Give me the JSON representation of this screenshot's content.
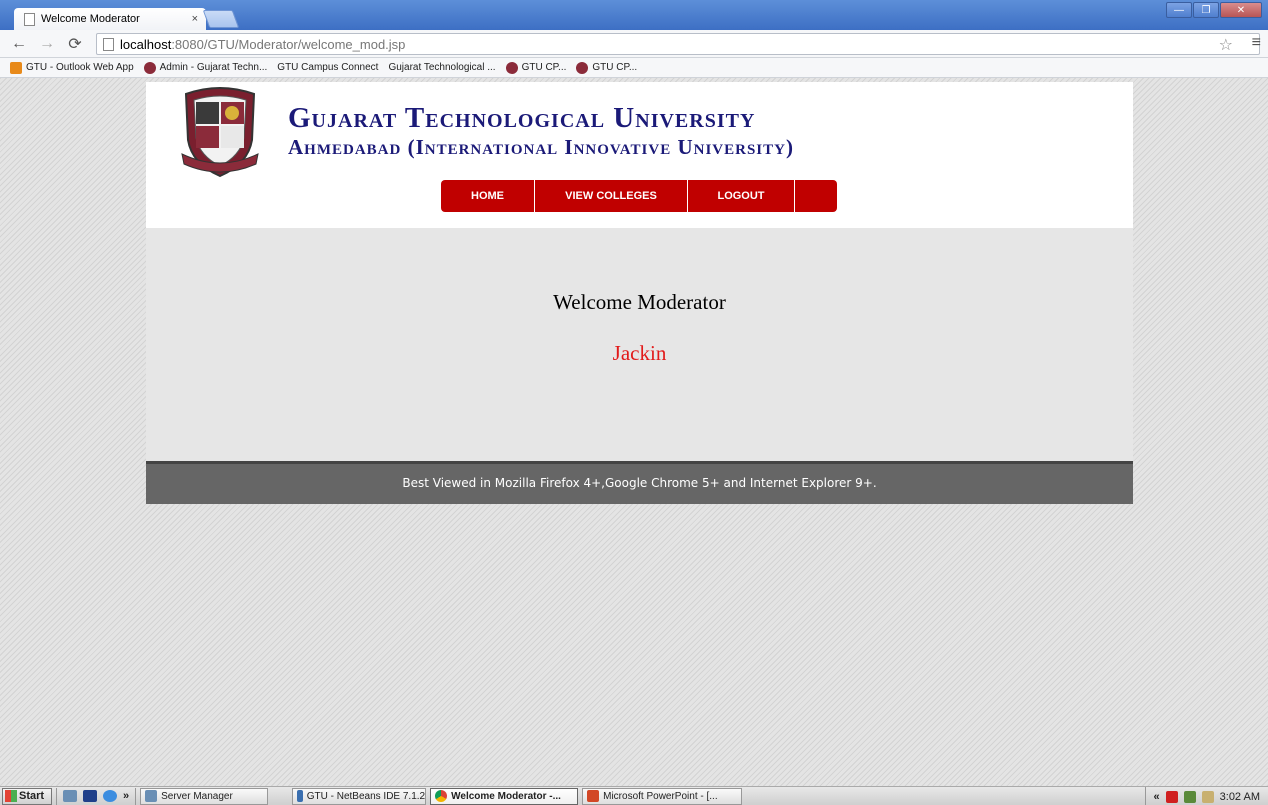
{
  "browser": {
    "tab_title": "Welcome Moderator",
    "tab_close": "×",
    "url_host": "localhost",
    "url_rest": ":8080/GTU/Moderator/welcome_mod.jsp",
    "window_buttons": {
      "minimize": "—",
      "maximize": "❐",
      "close": "✕"
    }
  },
  "bookmarks": [
    {
      "label": "GTU - Outlook Web App",
      "icon": "outlook-icon"
    },
    {
      "label": "Admin - Gujarat Techn...",
      "icon": "gtu-logo-icon"
    },
    {
      "label": "GTU Campus Connect",
      "icon": "page-icon"
    },
    {
      "label": "Gujarat Technological ...",
      "icon": "page-icon"
    },
    {
      "label": "GTU CP...",
      "icon": "gtu-logo-icon"
    },
    {
      "label": "GTU CP...",
      "icon": "gtu-logo-icon"
    }
  ],
  "header": {
    "title_line1": "Gujarat Technological University",
    "title_line2": "Ahmedabad (International Innovative University)"
  },
  "nav": {
    "home": "Home",
    "view_colleges": "View Colleges",
    "logout": "Logout"
  },
  "main": {
    "welcome": "Welcome Moderator",
    "username": "Jackin"
  },
  "footer": {
    "text": "Best Viewed in Mozilla Firefox 4+,Google Chrome 5+ and Internet Explorer 9+."
  },
  "taskbar": {
    "start": "Start",
    "more": "»",
    "items": [
      {
        "label": "Server Manager",
        "active": false
      },
      {
        "label": "GTU - NetBeans IDE 7.1.2",
        "active": false
      },
      {
        "label": "Welcome Moderator -...",
        "active": true
      },
      {
        "label": "Microsoft PowerPoint - [...",
        "active": false
      }
    ],
    "tray_expand": "«",
    "clock": "3:02 AM"
  },
  "colors": {
    "title_blue": "#1b1a78",
    "nav_red": "#c00000",
    "username_red": "#e21a1a",
    "footer_gray": "#666666"
  }
}
